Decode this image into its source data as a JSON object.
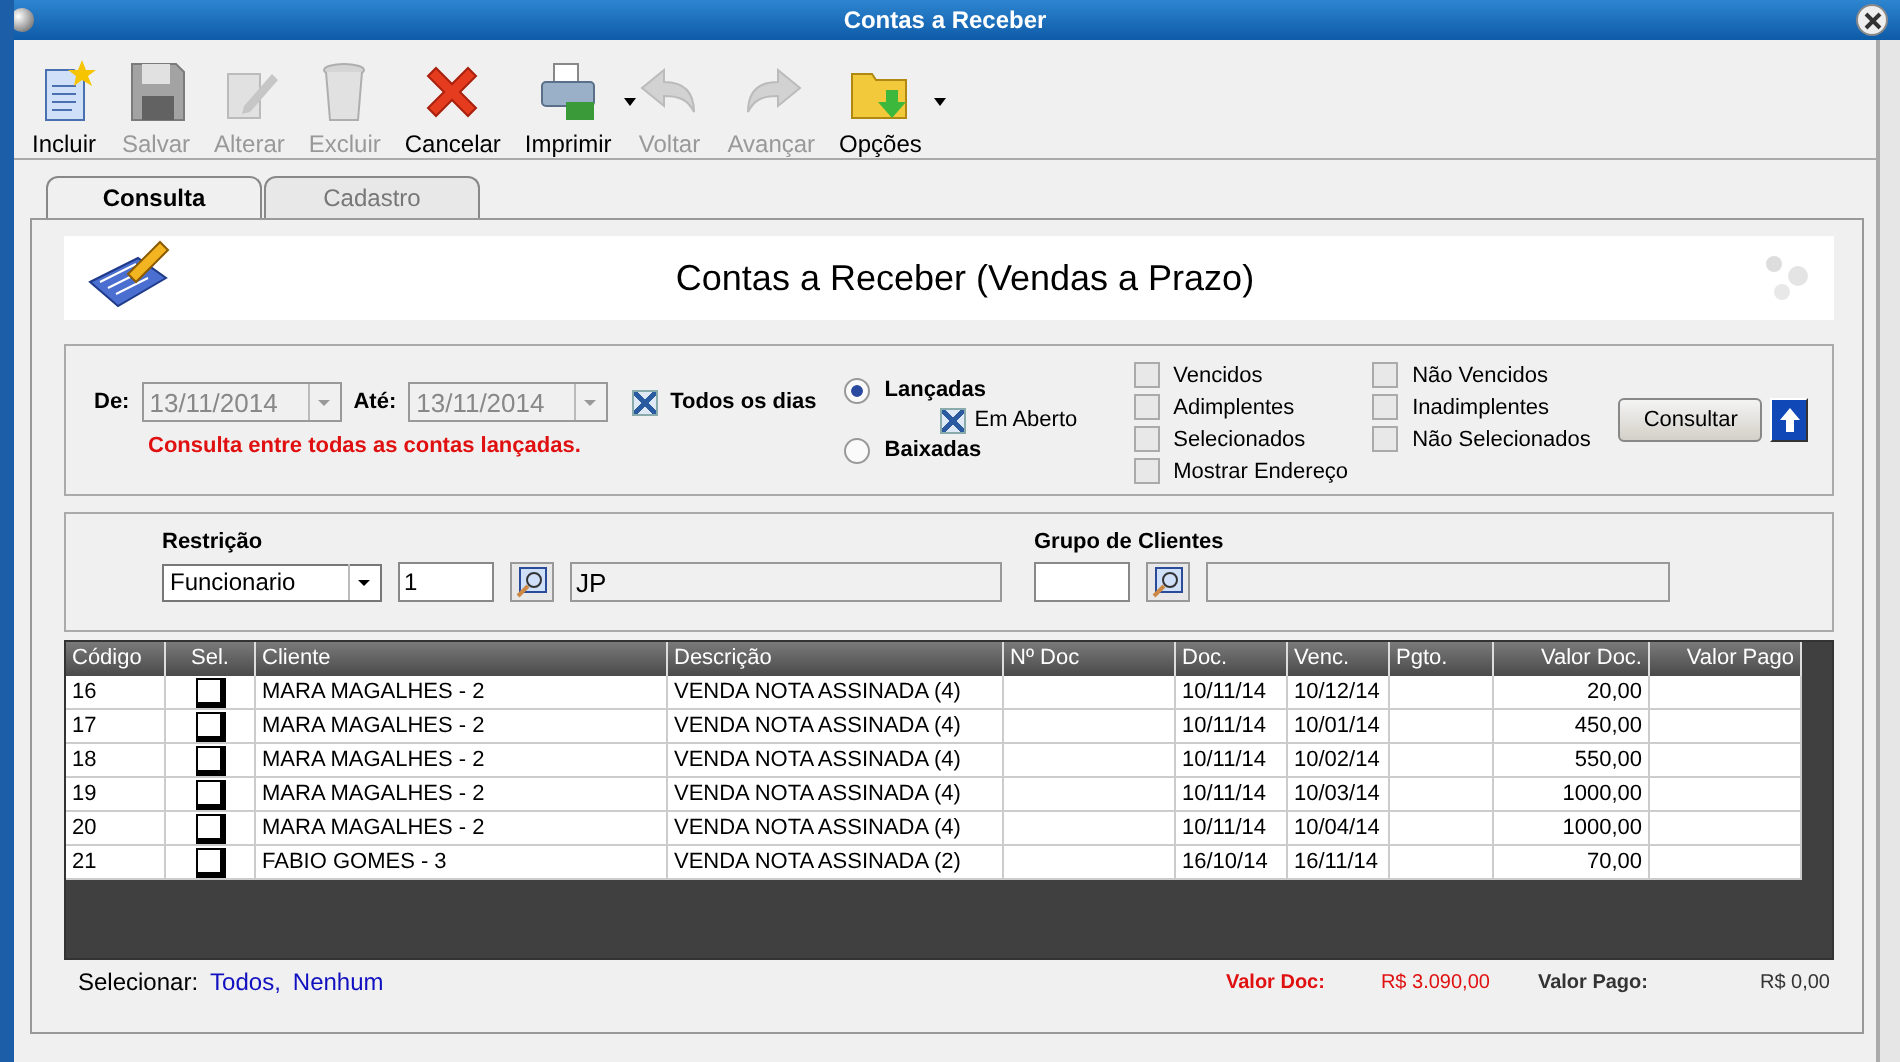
{
  "window": {
    "title": "Contas a Receber"
  },
  "toolbar": [
    {
      "label": "Incluir",
      "disabled": false,
      "dropdown": false
    },
    {
      "label": "Salvar",
      "disabled": true,
      "dropdown": false
    },
    {
      "label": "Alterar",
      "disabled": true,
      "dropdown": false
    },
    {
      "label": "Excluir",
      "disabled": true,
      "dropdown": false
    },
    {
      "label": "Cancelar",
      "disabled": false,
      "dropdown": false
    },
    {
      "label": "Imprimir",
      "disabled": false,
      "dropdown": true
    },
    {
      "label": "Voltar",
      "disabled": true,
      "dropdown": false
    },
    {
      "label": "Avançar",
      "disabled": true,
      "dropdown": false
    },
    {
      "label": "Opções",
      "disabled": false,
      "dropdown": true
    }
  ],
  "tabs": [
    {
      "label": "Consulta",
      "selected": true
    },
    {
      "label": "Cadastro",
      "selected": false
    }
  ],
  "banner": {
    "title": "Contas a Receber (Vendas a Prazo)"
  },
  "filters": {
    "date_from": {
      "label": "De:",
      "value": "13/11/2014"
    },
    "date_to": {
      "label": "Até:",
      "value": "13/11/2014"
    },
    "all_days": {
      "label": "Todos os dias",
      "checked": true
    },
    "note": "Consulta entre todas as contas lançadas.",
    "radios": [
      {
        "label": "Lançadas",
        "selected": true
      },
      {
        "label": "Baixadas",
        "selected": false
      }
    ],
    "open": {
      "label": "Em Aberto",
      "checked": true
    },
    "checks_left": [
      {
        "label": "Vencidos",
        "checked": false
      },
      {
        "label": "Adimplentes",
        "checked": false
      },
      {
        "label": "Selecionados",
        "checked": false
      },
      {
        "label": "Mostrar Endereço",
        "checked": false
      }
    ],
    "checks_right": [
      {
        "label": "Não Vencidos",
        "checked": false
      },
      {
        "label": "Inadimplentes",
        "checked": false
      },
      {
        "label": "Não Selecionados",
        "checked": false
      }
    ],
    "button": "Consultar"
  },
  "restriction": {
    "label": "Restrição",
    "select": "Funcionario",
    "code": "1",
    "name": "JP"
  },
  "group": {
    "label": "Grupo de Clientes"
  },
  "table": {
    "columns": [
      "Código",
      "Sel.",
      "Cliente",
      "Descrição",
      "Nº Doc",
      "Doc.",
      "Venc.",
      "Pgto.",
      "Valor Doc.",
      "Valor Pago"
    ],
    "rows": [
      {
        "code": "16",
        "selected": false,
        "client": "MARA MAGALHES - 2",
        "desc": "VENDA NOTA ASSINADA (4)",
        "doc": "10/11/14",
        "due": "10/12/14",
        "value": "20,00"
      },
      {
        "code": "17",
        "selected": false,
        "client": "MARA MAGALHES - 2",
        "desc": "VENDA NOTA ASSINADA (4)",
        "doc": "10/11/14",
        "due": "10/01/14",
        "value": "450,00"
      },
      {
        "code": "18",
        "selected": false,
        "client": "MARA MAGALHES - 2",
        "desc": "VENDA NOTA ASSINADA (4)",
        "doc": "10/11/14",
        "due": "10/02/14",
        "value": "550,00"
      },
      {
        "code": "19",
        "selected": false,
        "client": "MARA MAGALHES - 2",
        "desc": "VENDA NOTA ASSINADA (4)",
        "doc": "10/11/14",
        "due": "10/03/14",
        "value": "1000,00"
      },
      {
        "code": "20",
        "selected": false,
        "client": "MARA MAGALHES - 2",
        "desc": "VENDA NOTA ASSINADA (4)",
        "doc": "10/11/14",
        "due": "10/04/14",
        "value": "1000,00"
      },
      {
        "code": "21",
        "selected": false,
        "client": "FABIO GOMES - 3",
        "desc": "VENDA NOTA ASSINADA (2)",
        "doc": "16/10/14",
        "due": "16/11/14",
        "value": "70,00"
      }
    ]
  },
  "footer": {
    "select_label": "Selecionar:",
    "links": [
      "Todos,",
      "Nenhum"
    ],
    "doc_label": "Valor Doc:",
    "doc_total": "R$ 3.090,00",
    "paid_label": "Valor Pago:",
    "paid_total": "R$ 0,00"
  }
}
